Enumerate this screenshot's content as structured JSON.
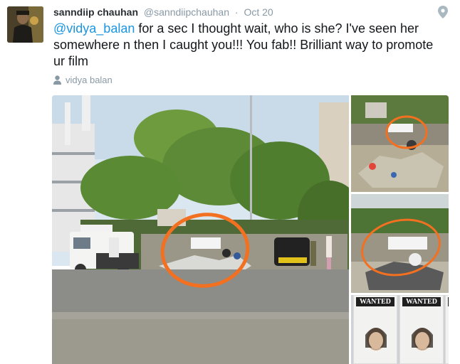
{
  "tweet": {
    "author_name": "sanndiip chauhan",
    "author_handle": "@sanndiipchauhan",
    "separator": "·",
    "timestamp": "Oct 20",
    "mention": "@vidya_balan",
    "body": " for a sec I thought wait, who is she? I've seen her somewhere n then I caught you!!! You fab!! Brilliant way to promote ur film",
    "context_label": "vidya balan",
    "media": {
      "poster_text": "WANTED"
    }
  },
  "colors": {
    "link": "#1b95e0",
    "meta": "#8899a6",
    "text": "#14171a",
    "annotation": "#f37021"
  },
  "icons": {
    "location": "location-pin-icon",
    "person": "person-icon"
  }
}
